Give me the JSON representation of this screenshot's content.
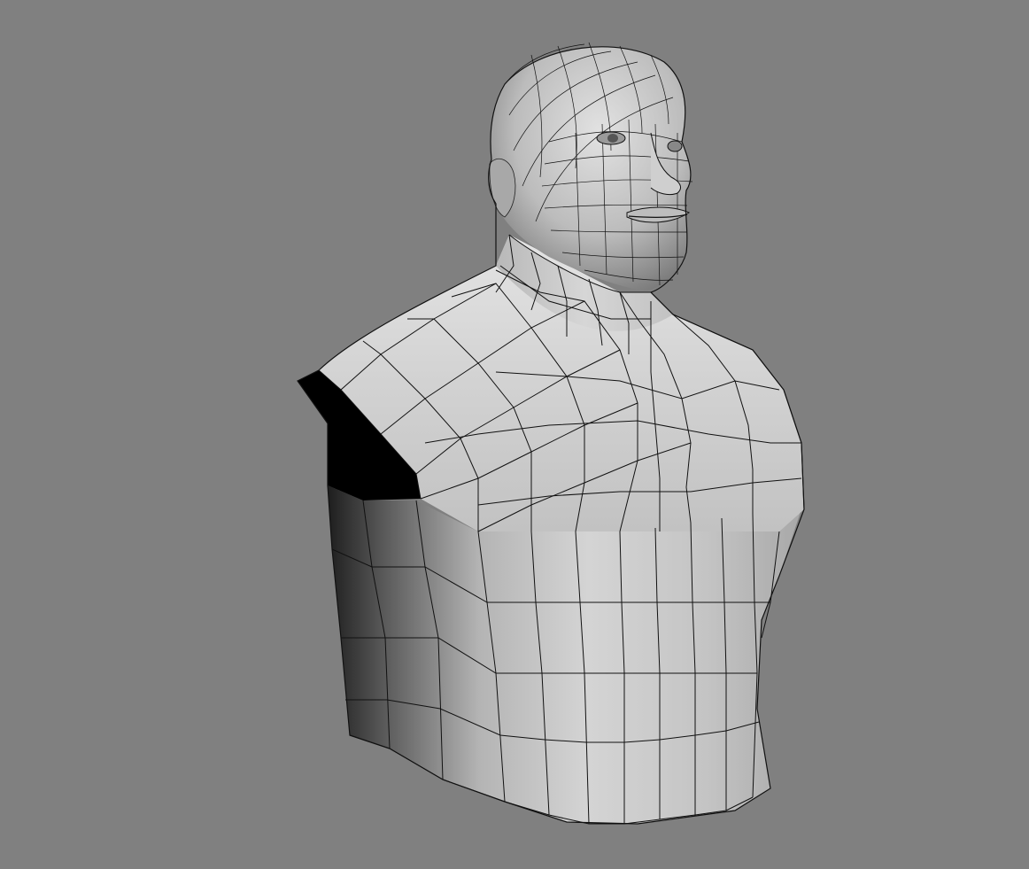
{
  "viewport": {
    "background_color": "#808080",
    "shading": "gray-lambert-with-wireframe"
  },
  "model": {
    "subject": "human-bust-base-mesh",
    "surface_color": "#bdbdbd",
    "highlight_color": "#e6e6e6",
    "shadow_color": "#3a3a3a",
    "wire_color": "#111111",
    "open_edge_color": "#000000"
  }
}
